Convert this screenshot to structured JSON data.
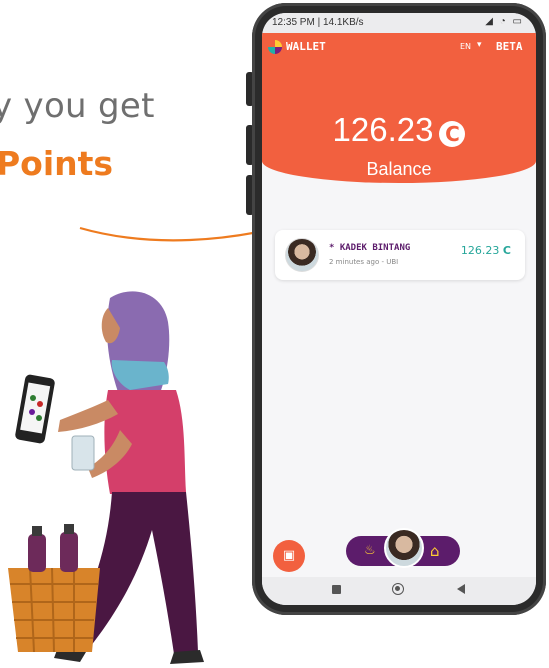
{
  "headline": {
    "line1": "y you get",
    "line2": "Points"
  },
  "colors": {
    "accent_orange": "#ee7b1f",
    "header_red": "#f2603f",
    "purple": "#5c1c6b",
    "teal": "#26a69a"
  },
  "phone": {
    "status_bar": {
      "left": "12:35 PM | 14.1KB/s",
      "right": "◢ ◔ ▭"
    },
    "app_header": {
      "title": "WALLET",
      "language": "EN",
      "language_arrow": "▾",
      "beta": "BETA"
    },
    "balance": {
      "amount": "126.23",
      "coin_symbol": "C",
      "label": "Balance"
    },
    "transactions": [
      {
        "name": "* KADEK BINTANG",
        "subtitle": "2 minutes ago - UBI",
        "amount": "126.23",
        "coin_symbol": "C"
      }
    ],
    "bottom": {
      "camera_icon": "camera-icon",
      "bell_icon": "bell-icon",
      "home_icon": "home-icon"
    }
  }
}
